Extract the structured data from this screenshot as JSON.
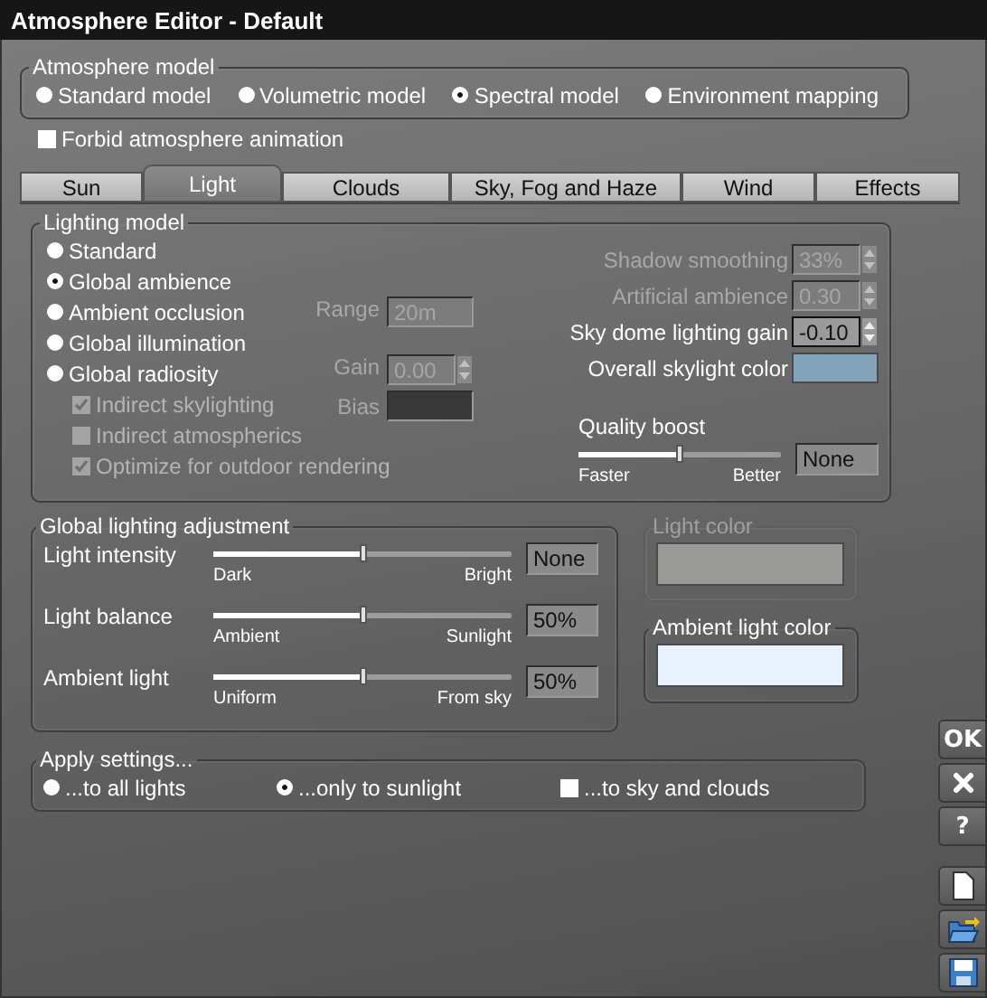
{
  "title": "Atmosphere Editor - Default",
  "atmosphere_model": {
    "label": "Atmosphere model",
    "options": [
      {
        "label": "Standard model",
        "selected": false
      },
      {
        "label": "Volumetric model",
        "selected": false
      },
      {
        "label": "Spectral model",
        "selected": true
      },
      {
        "label": "Environment mapping",
        "selected": false
      }
    ]
  },
  "forbid_animation": {
    "label": "Forbid atmosphere animation",
    "checked": false
  },
  "tabs": [
    {
      "label": "Sun",
      "selected": false
    },
    {
      "label": "Light",
      "selected": true
    },
    {
      "label": "Clouds",
      "selected": false
    },
    {
      "label": "Sky, Fog and Haze",
      "selected": false
    },
    {
      "label": "Wind",
      "selected": false
    },
    {
      "label": "Effects",
      "selected": false
    }
  ],
  "lighting_model": {
    "label": "Lighting model",
    "options": [
      {
        "label": "Standard",
        "selected": false
      },
      {
        "label": "Global ambience",
        "selected": true
      },
      {
        "label": "Ambient occlusion",
        "selected": false
      },
      {
        "label": "Global illumination",
        "selected": false
      },
      {
        "label": "Global radiosity",
        "selected": false
      }
    ],
    "sub_options": [
      {
        "label": "Indirect skylighting",
        "checked": true,
        "disabled": true
      },
      {
        "label": "Indirect atmospherics",
        "checked": false,
        "disabled": true
      },
      {
        "label": "Optimize for outdoor rendering",
        "checked": true,
        "disabled": true
      }
    ],
    "range": {
      "label": "Range",
      "value": "20m",
      "disabled": true
    },
    "gain": {
      "label": "Gain",
      "value": "0.00",
      "disabled": true
    },
    "bias": {
      "label": "Bias",
      "disabled": true
    },
    "settings": [
      {
        "kind": "spinner",
        "label": "Shadow smoothing",
        "value": "33%",
        "disabled": true
      },
      {
        "kind": "spinner",
        "label": "Artificial ambience",
        "value": "0.30",
        "disabled": true
      },
      {
        "kind": "spinner",
        "label": "Sky dome lighting gain",
        "value": "-0.10",
        "disabled": false
      },
      {
        "kind": "color",
        "label": "Overall skylight color",
        "color": "#84a4bc",
        "disabled": false
      }
    ],
    "quality_boost": {
      "label": "Quality boost",
      "level": 0.5,
      "min_label": "Faster",
      "max_label": "Better",
      "value": "None"
    }
  },
  "global_adjustment": {
    "label": "Global lighting adjustment",
    "sliders": [
      {
        "label": "Light intensity",
        "level": 0.5,
        "min_label": "Dark",
        "max_label": "Bright",
        "value": "None"
      },
      {
        "label": "Light balance",
        "level": 0.5,
        "min_label": "Ambient",
        "max_label": "Sunlight",
        "value": "50%"
      },
      {
        "label": "Ambient light",
        "level": 0.5,
        "min_label": "Uniform",
        "max_label": "From sky",
        "value": "50%"
      }
    ]
  },
  "light_color": {
    "label": "Light color",
    "color": "#9a9a96",
    "disabled": true
  },
  "ambient_light_color": {
    "label": "Ambient light color",
    "color": "#e8f2ff",
    "disabled": false
  },
  "apply_settings": {
    "label": "Apply settings...",
    "options": [
      {
        "kind": "radio",
        "label": "...to all lights",
        "selected": false
      },
      {
        "kind": "radio",
        "label": "...only to sunlight",
        "selected": true
      },
      {
        "kind": "checkbox",
        "label": "...to sky and clouds",
        "checked": false
      }
    ]
  },
  "side_buttons": [
    [
      {
        "kind": "text",
        "label": "OK"
      },
      {
        "kind": "close"
      },
      {
        "kind": "text",
        "label": "?"
      }
    ],
    [
      {
        "kind": "new"
      },
      {
        "kind": "open"
      },
      {
        "kind": "save"
      }
    ]
  ]
}
